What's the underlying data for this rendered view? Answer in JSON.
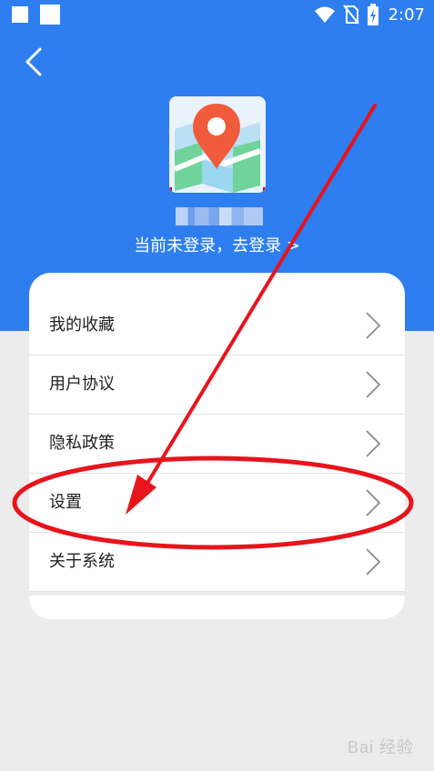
{
  "status_bar": {
    "time": "2:07",
    "icons": [
      "wifi-icon",
      "no-sim-icon",
      "battery-charging-icon"
    ]
  },
  "header": {
    "back_icon": "chevron-left-icon",
    "login_prompt": "当前未登录，去登录 >"
  },
  "menu": {
    "items": [
      {
        "label": "我的收藏"
      },
      {
        "label": "用户协议"
      },
      {
        "label": "隐私政策"
      },
      {
        "label": "设置"
      },
      {
        "label": "关于系统"
      }
    ]
  },
  "watermark": "Bai 经验",
  "colors": {
    "header_blue": "#2e7ef0",
    "annotation_red": "#e8141c",
    "page_bg": "#ececec"
  }
}
